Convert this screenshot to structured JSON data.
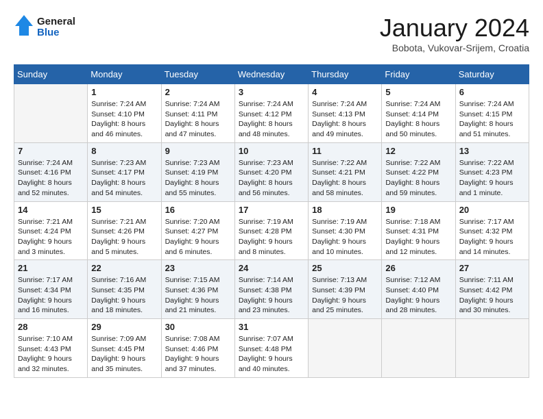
{
  "header": {
    "logo_line1": "General",
    "logo_line2": "Blue",
    "month": "January 2024",
    "location": "Bobota, Vukovar-Srijem, Croatia"
  },
  "weekdays": [
    "Sunday",
    "Monday",
    "Tuesday",
    "Wednesday",
    "Thursday",
    "Friday",
    "Saturday"
  ],
  "weeks": [
    [
      {
        "day": "",
        "empty": true
      },
      {
        "day": "1",
        "sunrise": "7:24 AM",
        "sunset": "4:10 PM",
        "daylight": "8 hours and 46 minutes."
      },
      {
        "day": "2",
        "sunrise": "7:24 AM",
        "sunset": "4:11 PM",
        "daylight": "8 hours and 47 minutes."
      },
      {
        "day": "3",
        "sunrise": "7:24 AM",
        "sunset": "4:12 PM",
        "daylight": "8 hours and 48 minutes."
      },
      {
        "day": "4",
        "sunrise": "7:24 AM",
        "sunset": "4:13 PM",
        "daylight": "8 hours and 49 minutes."
      },
      {
        "day": "5",
        "sunrise": "7:24 AM",
        "sunset": "4:14 PM",
        "daylight": "8 hours and 50 minutes."
      },
      {
        "day": "6",
        "sunrise": "7:24 AM",
        "sunset": "4:15 PM",
        "daylight": "8 hours and 51 minutes."
      }
    ],
    [
      {
        "day": "7",
        "sunrise": "7:24 AM",
        "sunset": "4:16 PM",
        "daylight": "8 hours and 52 minutes."
      },
      {
        "day": "8",
        "sunrise": "7:23 AM",
        "sunset": "4:17 PM",
        "daylight": "8 hours and 54 minutes."
      },
      {
        "day": "9",
        "sunrise": "7:23 AM",
        "sunset": "4:19 PM",
        "daylight": "8 hours and 55 minutes."
      },
      {
        "day": "10",
        "sunrise": "7:23 AM",
        "sunset": "4:20 PM",
        "daylight": "8 hours and 56 minutes."
      },
      {
        "day": "11",
        "sunrise": "7:22 AM",
        "sunset": "4:21 PM",
        "daylight": "8 hours and 58 minutes."
      },
      {
        "day": "12",
        "sunrise": "7:22 AM",
        "sunset": "4:22 PM",
        "daylight": "8 hours and 59 minutes."
      },
      {
        "day": "13",
        "sunrise": "7:22 AM",
        "sunset": "4:23 PM",
        "daylight": "9 hours and 1 minute."
      }
    ],
    [
      {
        "day": "14",
        "sunrise": "7:21 AM",
        "sunset": "4:24 PM",
        "daylight": "9 hours and 3 minutes."
      },
      {
        "day": "15",
        "sunrise": "7:21 AM",
        "sunset": "4:26 PM",
        "daylight": "9 hours and 5 minutes."
      },
      {
        "day": "16",
        "sunrise": "7:20 AM",
        "sunset": "4:27 PM",
        "daylight": "9 hours and 6 minutes."
      },
      {
        "day": "17",
        "sunrise": "7:19 AM",
        "sunset": "4:28 PM",
        "daylight": "9 hours and 8 minutes."
      },
      {
        "day": "18",
        "sunrise": "7:19 AM",
        "sunset": "4:30 PM",
        "daylight": "9 hours and 10 minutes."
      },
      {
        "day": "19",
        "sunrise": "7:18 AM",
        "sunset": "4:31 PM",
        "daylight": "9 hours and 12 minutes."
      },
      {
        "day": "20",
        "sunrise": "7:17 AM",
        "sunset": "4:32 PM",
        "daylight": "9 hours and 14 minutes."
      }
    ],
    [
      {
        "day": "21",
        "sunrise": "7:17 AM",
        "sunset": "4:34 PM",
        "daylight": "9 hours and 16 minutes."
      },
      {
        "day": "22",
        "sunrise": "7:16 AM",
        "sunset": "4:35 PM",
        "daylight": "9 hours and 18 minutes."
      },
      {
        "day": "23",
        "sunrise": "7:15 AM",
        "sunset": "4:36 PM",
        "daylight": "9 hours and 21 minutes."
      },
      {
        "day": "24",
        "sunrise": "7:14 AM",
        "sunset": "4:38 PM",
        "daylight": "9 hours and 23 minutes."
      },
      {
        "day": "25",
        "sunrise": "7:13 AM",
        "sunset": "4:39 PM",
        "daylight": "9 hours and 25 minutes."
      },
      {
        "day": "26",
        "sunrise": "7:12 AM",
        "sunset": "4:40 PM",
        "daylight": "9 hours and 28 minutes."
      },
      {
        "day": "27",
        "sunrise": "7:11 AM",
        "sunset": "4:42 PM",
        "daylight": "9 hours and 30 minutes."
      }
    ],
    [
      {
        "day": "28",
        "sunrise": "7:10 AM",
        "sunset": "4:43 PM",
        "daylight": "9 hours and 32 minutes."
      },
      {
        "day": "29",
        "sunrise": "7:09 AM",
        "sunset": "4:45 PM",
        "daylight": "9 hours and 35 minutes."
      },
      {
        "day": "30",
        "sunrise": "7:08 AM",
        "sunset": "4:46 PM",
        "daylight": "9 hours and 37 minutes."
      },
      {
        "day": "31",
        "sunrise": "7:07 AM",
        "sunset": "4:48 PM",
        "daylight": "9 hours and 40 minutes."
      },
      {
        "day": "",
        "empty": true
      },
      {
        "day": "",
        "empty": true
      },
      {
        "day": "",
        "empty": true
      }
    ]
  ],
  "labels": {
    "sunrise": "Sunrise:",
    "sunset": "Sunset:",
    "daylight": "Daylight:"
  }
}
